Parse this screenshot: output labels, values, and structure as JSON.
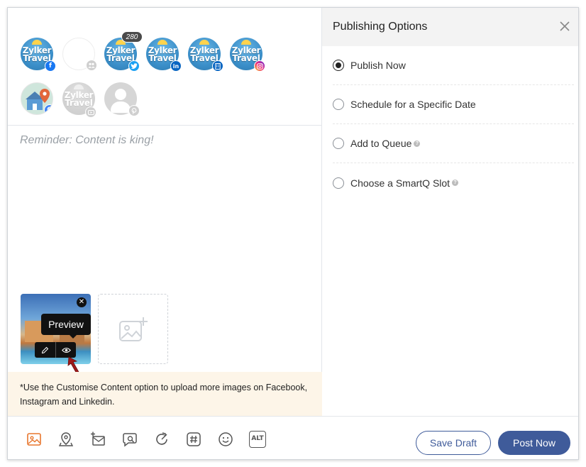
{
  "accounts": {
    "row1": [
      {
        "type": "zylker",
        "network": "facebook",
        "logo": "Zylker Travel",
        "badge_color": "#1877f2",
        "badge_icon": "f"
      },
      {
        "type": "empty",
        "network": "group",
        "badge_color": "#cfcfcf"
      },
      {
        "type": "zylker",
        "network": "twitter",
        "logo": "Zylker Travel",
        "badge_color": "#1da1f2",
        "count": "280"
      },
      {
        "type": "zylker",
        "network": "linkedin",
        "logo": "Zylker Travel",
        "badge_color": "#0a66c2",
        "badge_icon": "in"
      },
      {
        "type": "zylker",
        "network": "linkedin-page",
        "logo": "Zylker Travel",
        "badge_color": "#0a66c2"
      },
      {
        "type": "zylker",
        "network": "instagram",
        "logo": "Zylker Travel",
        "badge_color": "#d62976"
      }
    ],
    "row2": [
      {
        "type": "gmb",
        "network": "google",
        "badge_color": "#4285f4",
        "badge_icon": "G"
      },
      {
        "type": "zylker-dim",
        "network": "youtube",
        "logo": "Zylker Travel",
        "badge_color": "#cfcfcf"
      },
      {
        "type": "gray",
        "network": "pinterest",
        "badge_color": "#cfcfcf"
      }
    ]
  },
  "composer": {
    "reminder": "Reminder: Content is king!",
    "tooltip": "Preview",
    "notice": "*Use the Customise Content option to upload more images on Facebook, Instagram and Linkedin."
  },
  "publishing": {
    "title": "Publishing Options",
    "options": [
      {
        "label": "Publish Now",
        "selected": true,
        "help": false
      },
      {
        "label": "Schedule for a Specific Date",
        "selected": false,
        "help": false
      },
      {
        "label": "Add to Queue",
        "selected": false,
        "help": true
      },
      {
        "label": "Choose a SmartQ Slot",
        "selected": false,
        "help": true
      }
    ]
  },
  "toolbar": {
    "icons": [
      "image-icon",
      "location-icon",
      "add-mail-icon",
      "chat-image-icon",
      "refresh-share-icon",
      "hashtag-icon",
      "emoji-icon",
      "alt-text-icon"
    ],
    "alt_label": "ALT",
    "save_draft": "Save Draft",
    "post_now": "Post Now"
  },
  "colors": {
    "accent": "#3f5b9a",
    "image_icon": "#e8762d",
    "notice_bg": "#fdf5e8"
  }
}
